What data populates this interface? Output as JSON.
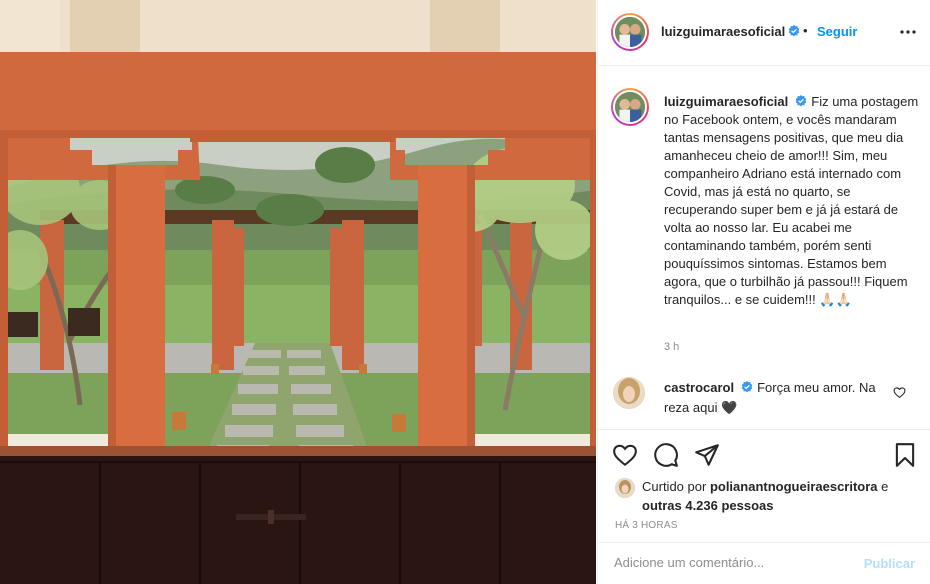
{
  "post": {
    "username": "luizguimaraesoficial",
    "follow_label": "Seguir",
    "dot": "•",
    "caption": "Fiz uma postagem no Facebook ontem, e vocês mandaram tantas mensagens positivas, que meu dia amanheceu cheio de amor!!! Sim, meu companheiro Adriano está internado com Covid, mas já está no quarto, se recuperando super bem e já já estará de volta ao nosso lar. Eu acabei me contaminando também, porém senti pouquíssimos sintomas. Estamos bem agora, que o turbilhão já passou!!! Fiquem tranquilos... e se cuidem!!! 🙏🏻🙏🏻",
    "caption_time": "3 h"
  },
  "comment": {
    "username": "castrocarol",
    "text": "Força meu amor. Na reza aqui 🖤"
  },
  "likes": {
    "prefix": "Curtido por",
    "user": "polianantnogueiraescritora",
    "connector": "e",
    "others": "outras 4.236 pessoas"
  },
  "time_ago": "HÁ 3 HORAS",
  "add_comment": {
    "placeholder": "Adicione um comentário...",
    "publish_label": "Publicar"
  },
  "colors": {
    "accent": "#0095f6",
    "publish_disabled": "#b2dffc",
    "secondary_text": "#8e8e8e",
    "verified": "#3897f0"
  },
  "icons": [
    "more-icon",
    "verified-icon",
    "heart-icon",
    "comment-icon",
    "share-icon",
    "bookmark-icon"
  ]
}
